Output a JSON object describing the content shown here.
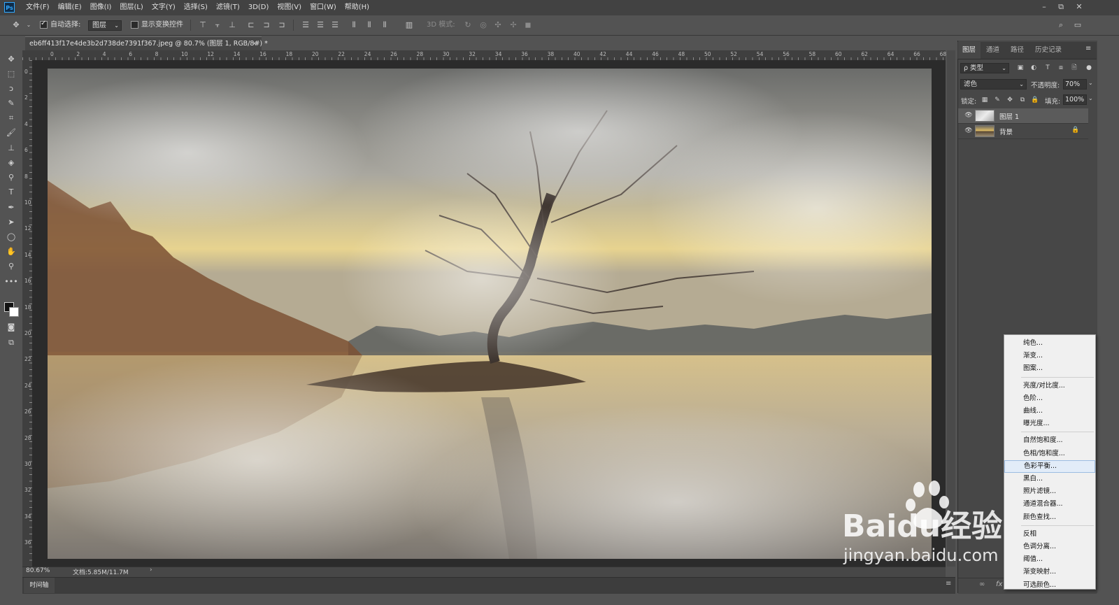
{
  "app": {
    "logo": "Ps"
  },
  "menubar": {
    "items": [
      "文件(F)",
      "编辑(E)",
      "图像(I)",
      "图层(L)",
      "文字(Y)",
      "选择(S)",
      "滤镜(T)",
      "3D(D)",
      "视图(V)",
      "窗口(W)",
      "帮助(H)"
    ]
  },
  "window_controls": {
    "minimize": "–",
    "restore": "⧉",
    "close": "✕"
  },
  "options": {
    "auto_select_label": "自动选择:",
    "auto_select_checked": true,
    "auto_select_target": "图层",
    "show_transform_label": "显示变换控件",
    "mode_3d_label": "3D 模式:"
  },
  "document": {
    "tab_title": "eb6ff413f17e4de3b2d738de7391f367.jpeg @ 80.7% (图层 1, RGB/8#) *",
    "close": "×"
  },
  "ruler": {
    "top": [
      "0",
      "2",
      "4",
      "6",
      "8",
      "10",
      "12",
      "14",
      "16",
      "18",
      "20",
      "22",
      "24",
      "26",
      "28",
      "30",
      "32",
      "34",
      "36",
      "38",
      "40",
      "42",
      "44",
      "46",
      "48",
      "50",
      "52",
      "54",
      "56",
      "58",
      "60",
      "62",
      "64",
      "66",
      "68"
    ],
    "left": [
      "0",
      "2",
      "4",
      "6",
      "8",
      "10",
      "12",
      "14",
      "16",
      "18",
      "20",
      "22",
      "24",
      "26",
      "28",
      "30",
      "32",
      "34",
      "36"
    ]
  },
  "status": {
    "zoom": "80.67%",
    "doc_info": "文档:5.85M/11.7M",
    "arrow": "›"
  },
  "timeline": {
    "tab": "时间轴",
    "menu": "≡"
  },
  "panel": {
    "tabs": [
      "图层",
      "通道",
      "路径",
      "历史记录"
    ],
    "menu": "≡",
    "kind_filter": "ρ 类型",
    "blend_mode": "滤色",
    "opacity_label": "不透明度:",
    "opacity_value": "70%",
    "lock_label": "锁定:",
    "fill_label": "填充:",
    "fill_value": "100%",
    "layers": [
      {
        "name": "图层 1",
        "selected": true
      },
      {
        "name": "背景",
        "locked": true
      }
    ],
    "bottom_link": "∞",
    "bottom_fx": "fx"
  },
  "adjustment_menu": {
    "groups": [
      [
        "纯色...",
        "渐变...",
        "图案..."
      ],
      [
        "亮度/对比度...",
        "色阶...",
        "曲线...",
        "曝光度..."
      ],
      [
        "自然饱和度...",
        "色相/饱和度...",
        "色彩平衡...",
        "黑白...",
        "照片滤镜...",
        "通道混合器...",
        "颜色查找..."
      ],
      [
        "反相",
        "色调分离...",
        "阈值...",
        "渐变映射...",
        "可选颜色..."
      ]
    ],
    "hover_item": "色彩平衡..."
  },
  "watermark": {
    "logo_text": "Baidu经验",
    "url": "jingyan.baidu.com"
  }
}
